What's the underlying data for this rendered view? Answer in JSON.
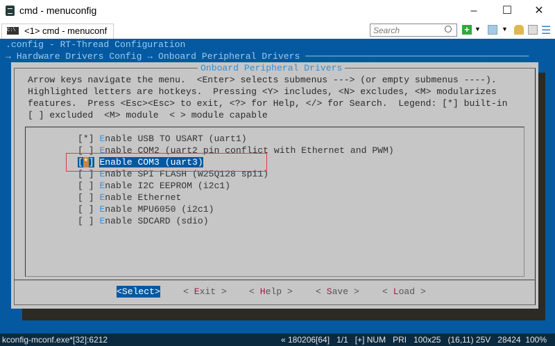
{
  "window": {
    "title": "cmd - menuconfig",
    "minimize": "–",
    "maximize": "☐",
    "close": "✕"
  },
  "tab": {
    "label": "<1> cmd - menuconf",
    "icon_text": "C:\\"
  },
  "toolbar": {
    "search_placeholder": "Search",
    "icons": [
      "search-icon",
      "add-console-icon",
      "dropdown-icon",
      "view-icon",
      "dropdown-icon",
      "lock-icon",
      "split-icon",
      "menu-icon"
    ]
  },
  "terminal": {
    "config_line": ".config - RT-Thread Configuration",
    "breadcrumb": "→ Hardware Drivers Config → Onboard Peripheral Drivers ─────────────────────────────────────────",
    "dialog_title": "Onboard Peripheral Drivers",
    "help": [
      "Arrow keys navigate the menu.  <Enter> selects submenus ---> (or empty submenus ----).",
      "Highlighted letters are hotkeys.  Pressing <Y> includes, <N> excludes, <M> modularizes",
      "features.  Press <Esc><Esc> to exit, <?> for Help, </> for Search.  Legend: [*] built-in",
      "[ ] excluded  <M> module  < > module capable"
    ],
    "items": [
      {
        "check": "[*]",
        "hotkey": "E",
        "rest": "nable USB TO USART (uart1)",
        "selected": false
      },
      {
        "check": "[ ]",
        "hotkey": "E",
        "rest": "nable COM2 (uart2 pin conflict with Ethernet and PWM)",
        "selected": false
      },
      {
        "check": "[*]",
        "hotkey": "E",
        "rest": "nable COM3 (uart3)",
        "selected": true
      },
      {
        "check": "[ ]",
        "hotkey": "E",
        "rest": "nable SPI FLASH (W25Q128 spi1)",
        "selected": false
      },
      {
        "check": "[ ]",
        "hotkey": "E",
        "rest": "nable I2C EEPROM (i2c1)",
        "selected": false
      },
      {
        "check": "[ ]",
        "hotkey": "E",
        "rest": "nable Ethernet",
        "selected": false
      },
      {
        "check": "[ ]",
        "hotkey": "E",
        "rest": "nable MPU6050 (i2c1)",
        "selected": false
      },
      {
        "check": "[ ]",
        "hotkey": "E",
        "rest": "nable SDCARD (sdio)",
        "selected": false
      }
    ],
    "buttons": [
      {
        "label": "<Select>",
        "selected": true
      },
      {
        "pre": "< ",
        "hotkey": "E",
        "rest": "xit >"
      },
      {
        "pre": "< ",
        "hotkey": "H",
        "rest": "elp >"
      },
      {
        "pre": "< ",
        "hotkey": "S",
        "rest": "ave >"
      },
      {
        "pre": "< ",
        "hotkey": "L",
        "rest": "oad >"
      }
    ]
  },
  "status": {
    "process": "kconfig-mconf.exe*[32]:6212",
    "info": "« 180206[64]   1/1   [+] NUM   PRI   100x25   (16,11) 25V   28424  100%"
  },
  "colors": {
    "terminal_bg": "#0559a1",
    "dialog_bg": "#c6c6c6",
    "hotkey": "#3a90e0",
    "button_hotkey": "#b0104a",
    "highlight_box": "#e03a3a"
  }
}
